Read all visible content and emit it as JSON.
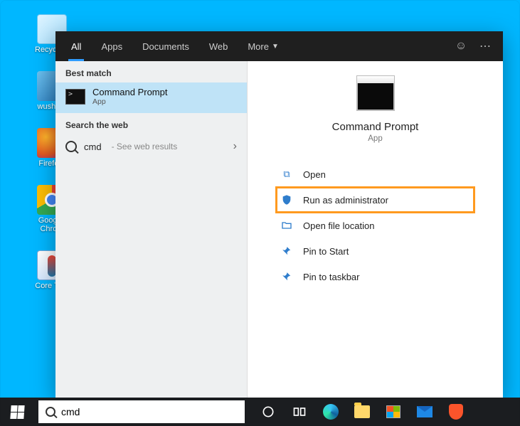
{
  "desktop": {
    "icons": [
      {
        "label": "Recycle..."
      },
      {
        "label": "wusho..."
      },
      {
        "label": "Firefo..."
      },
      {
        "label": "Googl...",
        "sub": "Chro..."
      },
      {
        "label": "Core Te..."
      }
    ]
  },
  "topbar": {
    "tabs": {
      "all": "All",
      "apps": "Apps",
      "documents": "Documents",
      "web": "Web",
      "more": "More"
    }
  },
  "left": {
    "best_match_h": "Best match",
    "best": {
      "title": "Command Prompt",
      "sub": "App"
    },
    "search_web_h": "Search the web",
    "web": {
      "query": "cmd",
      "hint": "- See web results"
    }
  },
  "right": {
    "title": "Command Prompt",
    "sub": "App",
    "actions": {
      "open": "Open",
      "run_admin": "Run as administrator",
      "open_loc": "Open file location",
      "pin_start": "Pin to Start",
      "pin_taskbar": "Pin to taskbar"
    }
  },
  "search": {
    "value": "cmd"
  }
}
